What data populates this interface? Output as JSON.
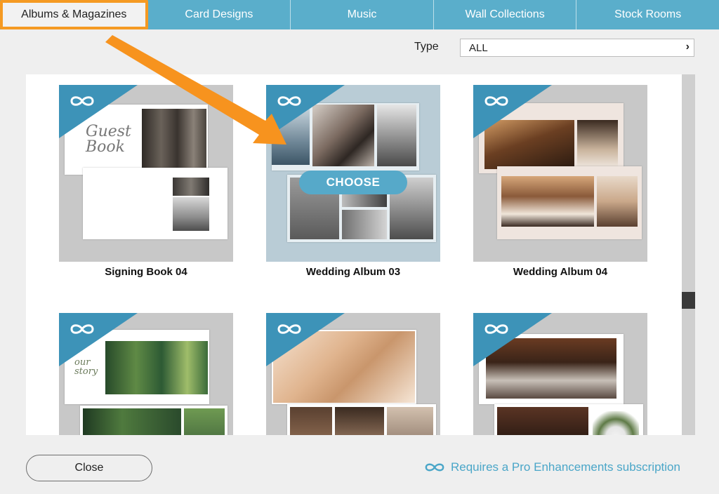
{
  "tabs": [
    {
      "label": "Albums & Magazines",
      "active": true
    },
    {
      "label": "Card Designs",
      "active": false
    },
    {
      "label": "Music",
      "active": false
    },
    {
      "label": "Wall Collections",
      "active": false
    },
    {
      "label": "Stock Rooms",
      "active": false
    }
  ],
  "filter": {
    "label": "Type",
    "value": "ALL"
  },
  "templates": [
    {
      "title": "Signing Book 04"
    },
    {
      "title": "Wedding Album 03",
      "hover_label": "CHOOSE"
    },
    {
      "title": "Wedding Album 04"
    },
    {
      "title": ""
    },
    {
      "title": ""
    },
    {
      "title": ""
    }
  ],
  "signing_book_text": "Guest Book",
  "our_story_text": "our story",
  "footer": {
    "close_label": "Close",
    "pro_note": "Requires a Pro Enhancements subscription"
  },
  "colors": {
    "tab_bg": "#5aaecb",
    "active_tab_outline": "#f59a23",
    "pro_accent": "#3d93b8",
    "annotation_arrow": "#f7931e"
  },
  "icons": {
    "pro_badge": "infinity-icon",
    "select_chevron": "chevron-right-icon"
  }
}
